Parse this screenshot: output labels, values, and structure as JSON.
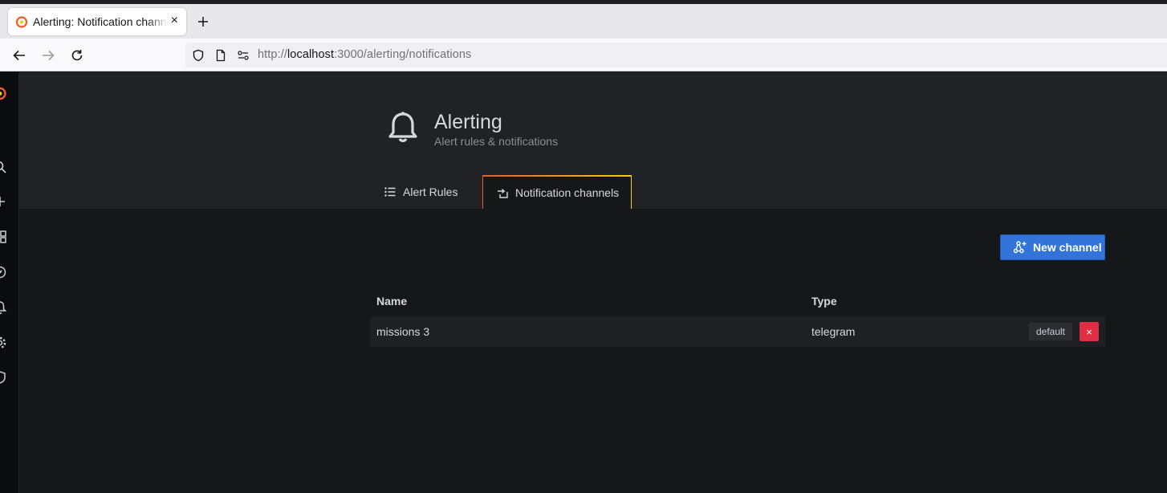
{
  "browser": {
    "tab_title": "Alerting: Notification channels - Grafana",
    "close_glyph": "×",
    "new_tab_glyph": "+",
    "url_scheme": "http://",
    "url_host": "localhost",
    "url_rest": ":3000/alerting/notifications"
  },
  "sidebar": {
    "icons": [
      "grafana-logo-icon",
      "search-icon",
      "plus-icon",
      "dashboards-icon",
      "explore-icon",
      "alerting-icon",
      "gear-icon",
      "shield-icon"
    ]
  },
  "header": {
    "title": "Alerting",
    "subtitle": "Alert rules & notifications"
  },
  "tabs": [
    {
      "label": "Alert Rules",
      "active": false
    },
    {
      "label": "Notification channels",
      "active": true
    }
  ],
  "actions": {
    "new_channel_label": "New channel"
  },
  "table": {
    "columns": [
      "Name",
      "Type"
    ],
    "rows": [
      {
        "name": "missions 3",
        "type": "telegram",
        "badge": "default",
        "delete_glyph": "×"
      }
    ]
  },
  "colors": {
    "primary": "#3274d9",
    "danger": "#e02f44",
    "background": "#161719",
    "header_bg": "#202226",
    "tab_accent_start": "#f05a28",
    "tab_accent_end": "#fbca0a"
  }
}
